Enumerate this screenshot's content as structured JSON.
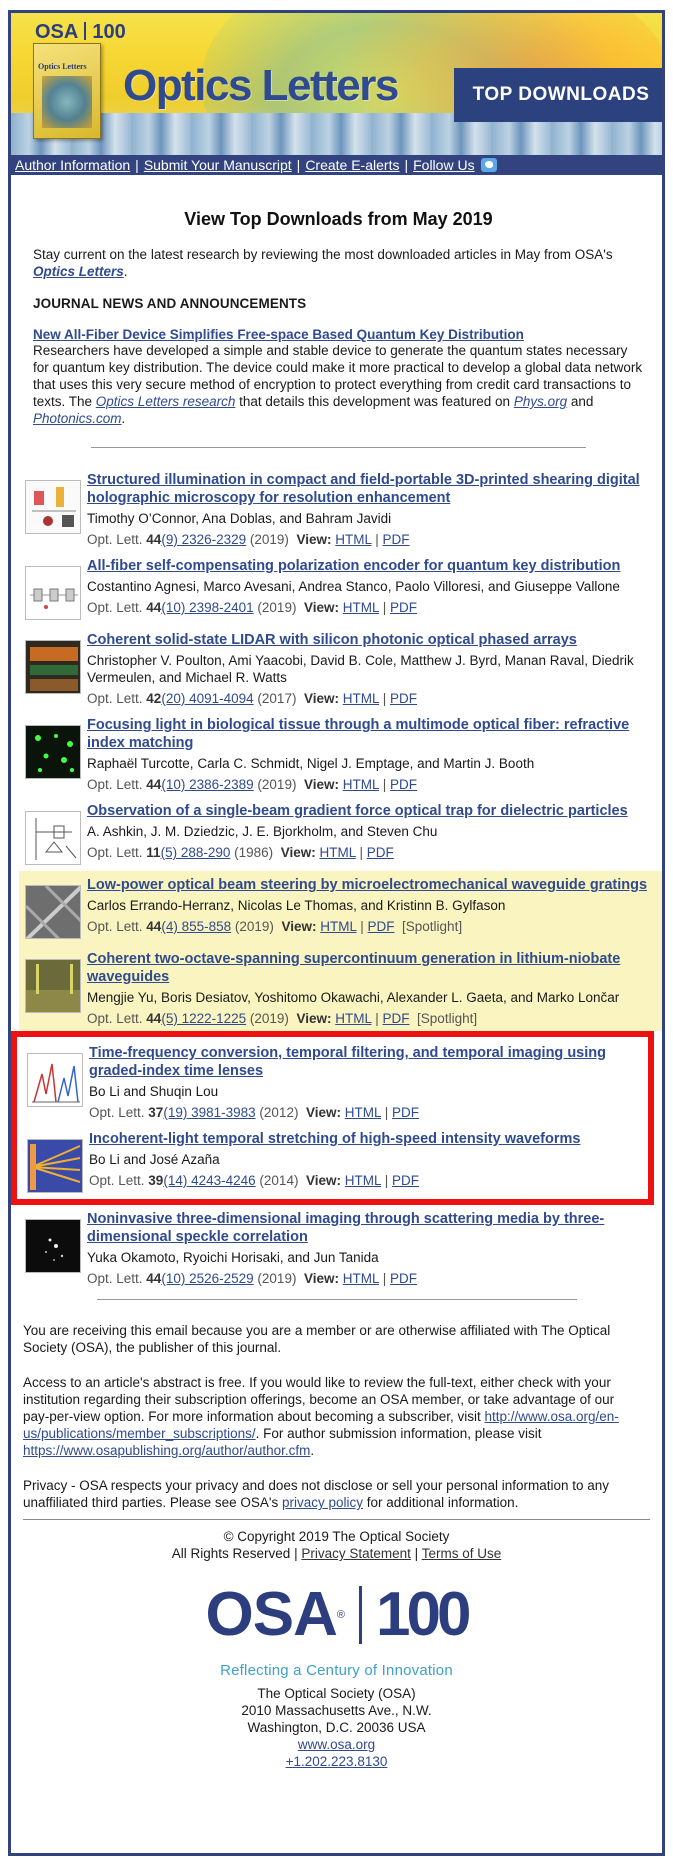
{
  "banner": {
    "osa": "OSA",
    "hundred": "100",
    "cover_title": "Optics Letters",
    "title": "Optics Letters",
    "tag": "TOP DOWNLOADS"
  },
  "nav": {
    "items": [
      "Author Information",
      "Submit Your Manuscript",
      "Create E-alerts",
      "Follow Us"
    ]
  },
  "page_title": "View Top Downloads from May 2019",
  "intro": {
    "text": "Stay current on the latest research by reviewing the most downloaded articles in May from OSA's",
    "journal": "Optics Letters",
    "end": "."
  },
  "news": {
    "heading": "JOURNAL NEWS AND ANNOUNCEMENTS",
    "title": "New All-Fiber Device Simplifies Free-space Based Quantum Key Distribution",
    "body1": "Researchers have developed a simple and stable device to generate the quantum states necessary for quantum key distribution. The device could make it more practical to develop a global data network that uses this very secure method of encryption to protect everything from credit card transactions to texts. The",
    "research_link": "Optics Letters research",
    "body2": "that details this development was featured on",
    "physorg": "Phys.org",
    "and": "and",
    "photonics": "Photonics.com",
    "end": "."
  },
  "articles": [
    {
      "title": "Structured illumination in compact and field-portable 3D-printed shearing digital holographic microscopy for resolution enhancement",
      "authors": "Timothy O’Connor, Ana Doblas, and Bahram Javidi",
      "journal": "Opt. Lett.",
      "vol": "44",
      "issue_pages": "(9) 2326-2329",
      "year": "(2019)",
      "spotlight": ""
    },
    {
      "title": "All-fiber self-compensating polarization encoder for quantum key distribution",
      "authors": "Costantino Agnesi, Marco Avesani, Andrea Stanco, Paolo Villoresi, and Giuseppe Vallone",
      "journal": "Opt. Lett.",
      "vol": "44",
      "issue_pages": "(10) 2398-2401",
      "year": "(2019)",
      "spotlight": ""
    },
    {
      "title": "Coherent solid-state LIDAR with silicon photonic optical phased arrays",
      "authors": "Christopher V. Poulton, Ami Yaacobi, David B. Cole, Matthew J. Byrd, Manan Raval, Diedrik Vermeulen, and Michael R. Watts",
      "journal": "Opt. Lett.",
      "vol": "42",
      "issue_pages": "(20) 4091-4094",
      "year": "(2017)",
      "spotlight": ""
    },
    {
      "title": "Focusing light in biological tissue through a multimode optical fiber: refractive index matching",
      "authors": "Raphaël Turcotte, Carla C. Schmidt, Nigel J. Emptage, and Martin J. Booth",
      "journal": "Opt. Lett.",
      "vol": "44",
      "issue_pages": "(10) 2386-2389",
      "year": "(2019)",
      "spotlight": ""
    },
    {
      "title": "Observation of a single-beam gradient force optical trap for dielectric particles",
      "authors": "A. Ashkin, J. M. Dziedzic, J. E. Bjorkholm, and Steven Chu",
      "journal": "Opt. Lett.",
      "vol": "11",
      "issue_pages": "(5) 288-290",
      "year": "(1986)",
      "spotlight": ""
    },
    {
      "title": "Low-power optical beam steering by microelectromechanical waveguide gratings",
      "authors": "Carlos Errando-Herranz, Nicolas Le Thomas, and Kristinn B. Gylfason",
      "journal": "Opt. Lett.",
      "vol": "44",
      "issue_pages": "(4) 855-858",
      "year": "(2019)",
      "spotlight": "[Spotlight]"
    },
    {
      "title": "Coherent two-octave-spanning supercontinuum generation in lithium-niobate waveguides",
      "authors": "Mengjie Yu, Boris Desiatov, Yoshitomo Okawachi, Alexander L. Gaeta, and Marko Lončar",
      "journal": "Opt. Lett.",
      "vol": "44",
      "issue_pages": "(5) 1222-1225",
      "year": "(2019)",
      "spotlight": "[Spotlight]"
    },
    {
      "title": "Time-frequency conversion, temporal filtering, and temporal imaging using graded-index time lenses",
      "authors": "Bo Li and Shuqin Lou",
      "journal": "Opt. Lett.",
      "vol": "37",
      "issue_pages": "(19) 3981-3983",
      "year": "(2012)",
      "spotlight": ""
    },
    {
      "title": "Incoherent-light temporal stretching of high-speed intensity waveforms",
      "authors": "Bo Li and José Azaña",
      "journal": "Opt. Lett.",
      "vol": "39",
      "issue_pages": "(14) 4243-4246",
      "year": "(2014)",
      "spotlight": ""
    },
    {
      "title": "Noninvasive three-dimensional imaging through scattering media by three-dimensional speckle correlation",
      "authors": "Yuka Okamoto, Ryoichi Horisaki, and Jun Tanida",
      "journal": "Opt. Lett.",
      "vol": "44",
      "issue_pages": "(10) 2526-2529",
      "year": "(2019)",
      "spotlight": ""
    }
  ],
  "labels": {
    "view": "View:",
    "html": "HTML",
    "pdf": "PDF",
    "pipe": "|"
  },
  "footer": {
    "member_note": "You are receiving this email because you are a member or are otherwise affiliated with The Optical Society (OSA), the publisher of this journal.",
    "access1": "Access to an article's abstract is free. If you would like to review the full-text, either check with your institution regarding their subscription offerings, become an OSA member, or take advantage of our pay-per-view option. For more information about becoming a subscriber, visit",
    "subs_link": "http://www.osa.org/en-us/publications/member_subscriptions/",
    "access2": ". For author submission information, please visit",
    "author_link": "https://www.osapublishing.org/author/author.cfm",
    "access3": ".",
    "privacy1": "Privacy - OSA respects your privacy and does not disclose or sell your personal information to any unaffiliated third parties. Please see OSA's",
    "privacy_link": "privacy policy",
    "privacy2": "for additional information.",
    "copyright": "© Copyright 2019 The Optical Society",
    "rights": "All Rights Reserved",
    "privacy_statement": "Privacy Statement",
    "terms": "Terms of Use",
    "logo_osa": "OSA",
    "logo_reg": "®",
    "logo_hundred": "100",
    "tagline": "Reflecting a Century of Innovation",
    "org": "The Optical Society (OSA)",
    "street": "2010 Massachusetts Ave., N.W.",
    "city": "Washington, D.C. 20036 USA",
    "web": "www.osa.org",
    "phone": "+1.202.223.8130"
  }
}
